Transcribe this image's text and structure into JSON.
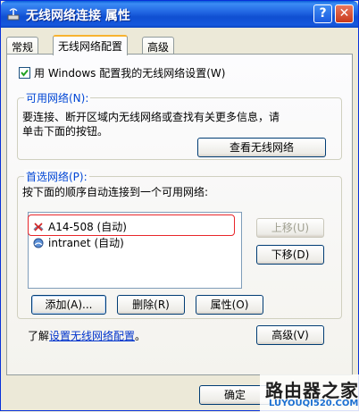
{
  "window": {
    "title": "无线网络连接 属性"
  },
  "titlebar_buttons": {
    "help": "?",
    "close": "✕"
  },
  "tabs": [
    {
      "label": "常规"
    },
    {
      "label": "无线网络配置"
    },
    {
      "label": "高级"
    }
  ],
  "checkbox": {
    "label": "用 Windows 配置我的无线网络设置(W)",
    "checked": true
  },
  "available": {
    "legend": "可用网络(N):",
    "line1": "要连接、断开区域内无线网络或查找有关更多信息，请",
    "line2": "单击下面的按钮。",
    "view_button": "查看无线网络"
  },
  "preferred": {
    "legend": "首选网络(P):",
    "description": "按下面的顺序自动连接到一个可用网络:",
    "networks": [
      {
        "name": "A14-508 (自动)",
        "icon": "wireless-network-unavailable-icon"
      },
      {
        "name": "intranet (自动)",
        "icon": "wireless-network-icon"
      }
    ],
    "move_up": "上移(U)",
    "move_down": "下移(D)",
    "add": "添加(A)...",
    "remove": "删除(R)",
    "properties": "属性(O)"
  },
  "learn": {
    "prefix": "了解",
    "link": "设置无线网络配置",
    "suffix": "。"
  },
  "advanced_button": "高级(V)",
  "ok_button": "确定",
  "watermark": {
    "title": "路由器之家",
    "url": "LUYOUQI520.COM"
  },
  "colors": {
    "titlebar": "#0a5fd8",
    "highlight_border": "#e8262a",
    "link": "#0033cc"
  }
}
